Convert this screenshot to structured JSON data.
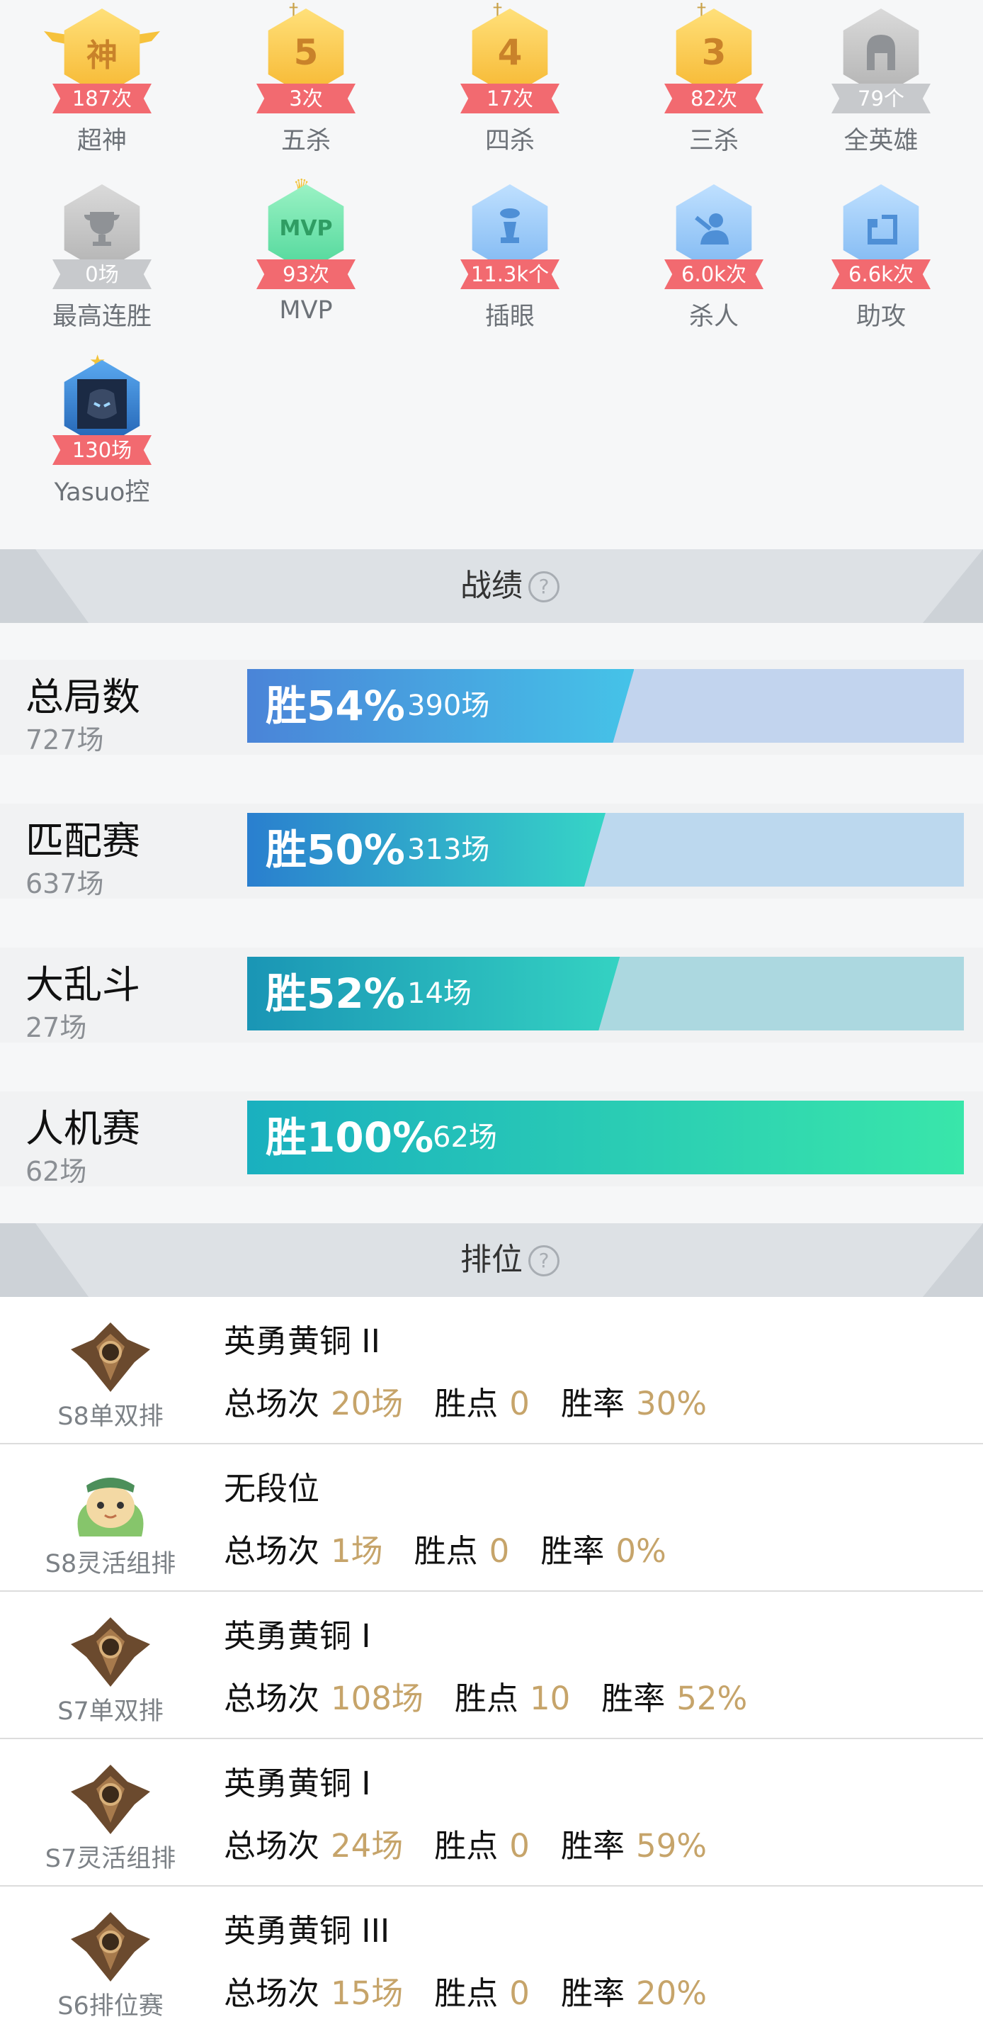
{
  "badges": [
    {
      "icon": "god-badge-icon",
      "glyph": "神",
      "count": "187次",
      "label": "超神",
      "tone": "gold"
    },
    {
      "icon": "penta-kill-badge-icon",
      "glyph": "5",
      "count": "3次",
      "label": "五杀",
      "tone": "gold"
    },
    {
      "icon": "quadra-kill-badge-icon",
      "glyph": "4",
      "count": "17次",
      "label": "四杀",
      "tone": "gold"
    },
    {
      "icon": "triple-kill-badge-icon",
      "glyph": "3",
      "count": "82次",
      "label": "三杀",
      "tone": "gold"
    },
    {
      "icon": "all-heroes-badge-icon",
      "glyph": "",
      "count": "79个",
      "label": "全英雄",
      "tone": "grey"
    },
    {
      "icon": "trophy-badge-icon",
      "glyph": "",
      "count": "0场",
      "label": "最高连胜",
      "tone": "grey"
    },
    {
      "icon": "mvp-badge-icon",
      "glyph": "MVP",
      "count": "93次",
      "label": "MVP",
      "tone": "green"
    },
    {
      "icon": "ward-badge-icon",
      "glyph": "",
      "count": "11.3k个",
      "label": "插眼",
      "tone": "blue"
    },
    {
      "icon": "kill-badge-icon",
      "glyph": "",
      "count": "6.0k次",
      "label": "杀人",
      "tone": "blue"
    },
    {
      "icon": "assist-badge-icon",
      "glyph": "",
      "count": "6.6k次",
      "label": "助攻",
      "tone": "blue"
    },
    {
      "icon": "hero-portrait-badge-icon",
      "glyph": "",
      "count": "130场",
      "label": "Yasuo控",
      "tone": "hero"
    }
  ],
  "record_section": {
    "title": "战绩",
    "help_icon": "question-circle-icon",
    "help_glyph": "?"
  },
  "stats": [
    {
      "name": "总局数",
      "games": "727场",
      "rate": "胜54%",
      "count": "390场",
      "win_fraction": 0.54,
      "colors": [
        "#4a84d8",
        "#45c3e8"
      ],
      "track": "#c2d4ee"
    },
    {
      "name": "匹配赛",
      "games": "637场",
      "rate": "胜50%",
      "count": "313场",
      "win_fraction": 0.5,
      "colors": [
        "#2a7fcf",
        "#36d5c6"
      ],
      "track": "#bcd8ee"
    },
    {
      "name": "大乱斗",
      "games": "27场",
      "rate": "胜52%",
      "count": "14场",
      "win_fraction": 0.52,
      "colors": [
        "#1a95b5",
        "#34d2c2"
      ],
      "track": "#acd8e0"
    },
    {
      "name": "人机赛",
      "games": "62场",
      "rate": "胜100%",
      "count": "62场",
      "win_fraction": 1.0,
      "colors": [
        "#1ab0bf",
        "#39e6aa"
      ],
      "track": "#b6e9e2"
    }
  ],
  "rank_section": {
    "title": "排位",
    "help_icon": "question-circle-icon",
    "help_glyph": "?"
  },
  "ranks": [
    {
      "emblem": "bronze-emblem-icon",
      "queue": "S8单双排",
      "tier": "英勇黄铜 II",
      "total_label": "总场次",
      "total": "20场",
      "points_label": "胜点",
      "points": "0",
      "rate_label": "胜率",
      "rate": "30%"
    },
    {
      "emblem": "unranked-poro-icon",
      "queue": "S8灵活组排",
      "tier": "无段位",
      "total_label": "总场次",
      "total": "1场",
      "points_label": "胜点",
      "points": "0",
      "rate_label": "胜率",
      "rate": "0%"
    },
    {
      "emblem": "bronze-emblem-icon",
      "queue": "S7单双排",
      "tier": "英勇黄铜 I",
      "total_label": "总场次",
      "total": "108场",
      "points_label": "胜点",
      "points": "10",
      "rate_label": "胜率",
      "rate": "52%"
    },
    {
      "emblem": "bronze-emblem-icon",
      "queue": "S7灵活组排",
      "tier": "英勇黄铜 I",
      "total_label": "总场次",
      "total": "24场",
      "points_label": "胜点",
      "points": "0",
      "rate_label": "胜率",
      "rate": "59%"
    },
    {
      "emblem": "bronze-emblem-icon",
      "queue": "S6排位赛",
      "tier": "英勇黄铜 III",
      "total_label": "总场次",
      "total": "15场",
      "points_label": "胜点",
      "points": "0",
      "rate_label": "胜率",
      "rate": "20%"
    }
  ]
}
